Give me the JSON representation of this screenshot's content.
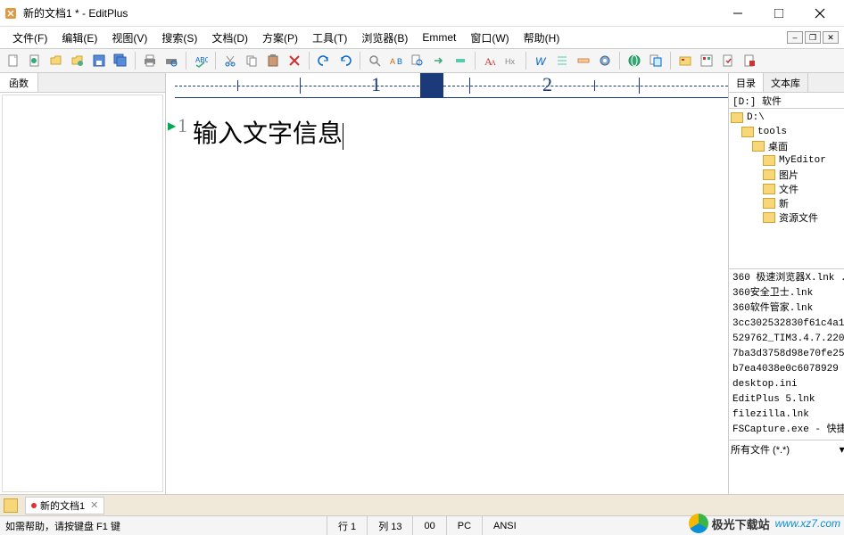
{
  "window": {
    "title": "新的文档1 * - EditPlus"
  },
  "menu": {
    "file": "文件(F)",
    "edit": "编辑(E)",
    "view": "视图(V)",
    "search": "搜索(S)",
    "document": "文档(D)",
    "project": "方案(P)",
    "tools": "工具(T)",
    "browser": "浏览器(B)",
    "emmet": "Emmet",
    "window": "窗口(W)",
    "help": "帮助(H)"
  },
  "left_panel": {
    "tab": "函数"
  },
  "ruler": {
    "n1": "1",
    "n2": "2"
  },
  "editor": {
    "line_no": "1",
    "content": "输入文字信息"
  },
  "right_panel": {
    "tab_dir": "目录",
    "tab_txt": "文本库",
    "drive": "[D:] 软件",
    "tree": [
      "D:\\",
      "tools",
      "桌面",
      "MyEditor",
      "图片",
      "文件",
      "新",
      "资源文件"
    ],
    "tree_indent": [
      0,
      1,
      2,
      3,
      3,
      3,
      3,
      3
    ],
    "selected_index": 2,
    "files": [
      "360 极速浏览器X.lnk .",
      "360安全卫士.lnk",
      "360软件管家.lnk",
      "3cc302532830f61c4a1",
      "529762_TIM3.4.7.220",
      "7ba3d3758d98e70fe25",
      "b7ea4038e0c6078929",
      "desktop.ini",
      "EditPlus 5.lnk",
      "filezilla.lnk",
      "FSCapture.exe - 快捷"
    ],
    "filter": "所有文件 (*.*)"
  },
  "tabs": {
    "doc1": "新的文档1",
    "close": "✕"
  },
  "status": {
    "help": "如需帮助，请按键盘 F1 键",
    "line": "行 1",
    "col": "列 13",
    "sel": "00",
    "mode": "PC",
    "enc": "ANSI"
  },
  "watermark": {
    "name": "极光下载站",
    "url": "www.xz7.com"
  }
}
